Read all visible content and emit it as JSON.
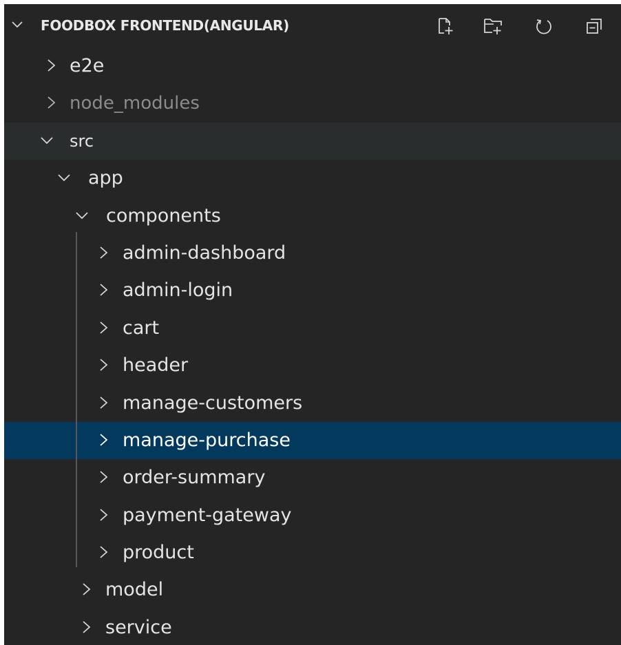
{
  "explorer": {
    "title": "FOODBOX FRONTEND(ANGULAR)",
    "actions": [
      {
        "name": "new-file-icon"
      },
      {
        "name": "new-folder-icon"
      },
      {
        "name": "refresh-icon"
      },
      {
        "name": "collapse-all-icon"
      }
    ]
  },
  "tree": [
    {
      "label": "e2e",
      "state": "collapsed"
    },
    {
      "label": "node_modules",
      "state": "collapsed"
    },
    {
      "label": "src",
      "state": "expanded"
    },
    {
      "label": "app",
      "state": "expanded"
    },
    {
      "label": "components",
      "state": "expanded"
    },
    {
      "label": "admin-dashboard",
      "state": "collapsed"
    },
    {
      "label": "admin-login",
      "state": "collapsed"
    },
    {
      "label": "cart",
      "state": "collapsed"
    },
    {
      "label": "header",
      "state": "collapsed"
    },
    {
      "label": "manage-customers",
      "state": "collapsed"
    },
    {
      "label": "manage-purchase",
      "state": "collapsed",
      "selected": true
    },
    {
      "label": "order-summary",
      "state": "collapsed"
    },
    {
      "label": "payment-gateway",
      "state": "collapsed"
    },
    {
      "label": "product",
      "state": "collapsed"
    },
    {
      "label": "model",
      "state": "collapsed"
    },
    {
      "label": "service",
      "state": "collapsed"
    }
  ],
  "colors": {
    "background": "#252526",
    "selected_row": "#04395e",
    "text": "#e4e4e4",
    "dim_text": "#8b8b8b"
  }
}
